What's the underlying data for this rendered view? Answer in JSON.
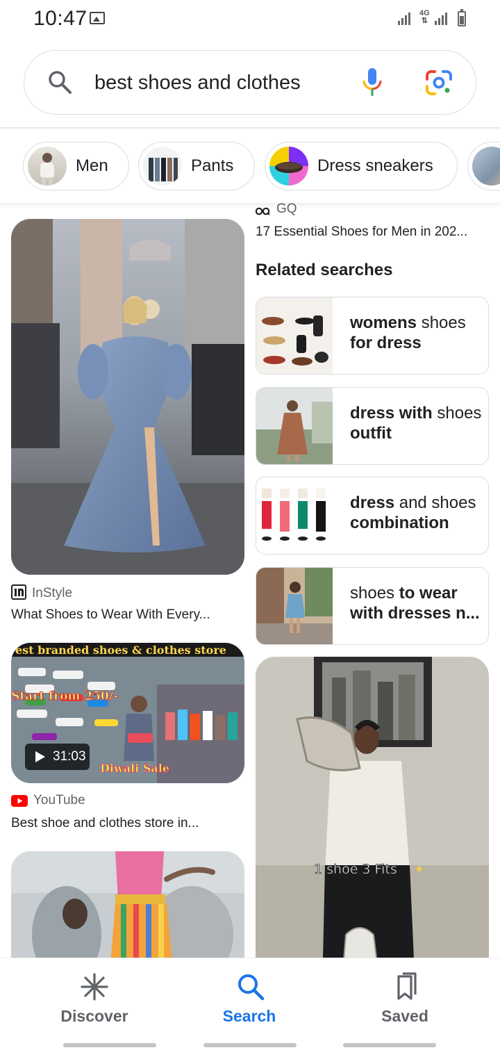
{
  "status_bar": {
    "time": "10:47",
    "network": "4G"
  },
  "search": {
    "query": "best shoes and clothes"
  },
  "chips": [
    {
      "label": "Men"
    },
    {
      "label": "Pants"
    },
    {
      "label": "Dress sneakers"
    }
  ],
  "results_left": [
    {
      "source": "InStyle",
      "title": "What Shoes to Wear With Every..."
    },
    {
      "source": "YouTube",
      "title": "Best shoe and clothes store in...",
      "duration": "31:03",
      "thumb_text": [
        "est branded shoes & clothes store",
        "Start from 250/-",
        "Diwali Sale"
      ]
    }
  ],
  "results_right_top": {
    "source": "GQ",
    "title": "17 Essential Shoes for Men in 202..."
  },
  "related": {
    "heading": "Related searches",
    "items": [
      {
        "parts": [
          {
            "t": "womens",
            "bold": true
          },
          {
            "t": " shoes ",
            "bold": false
          },
          {
            "t": "for dress",
            "bold": true
          }
        ]
      },
      {
        "parts": [
          {
            "t": "dress with",
            "bold": true
          },
          {
            "t": " shoes ",
            "bold": false
          },
          {
            "t": "outfit",
            "bold": true
          }
        ]
      },
      {
        "parts": [
          {
            "t": "dress",
            "bold": true
          },
          {
            "t": " and shoes ",
            "bold": false
          },
          {
            "t": "combination",
            "bold": true
          }
        ]
      },
      {
        "parts": [
          {
            "t": "shoes ",
            "bold": false
          },
          {
            "t": "to wear with dresses n...",
            "bold": true
          }
        ]
      }
    ]
  },
  "right_image_caption": "1 shoe 3 Fits",
  "bottom_nav": [
    {
      "label": "Discover",
      "icon": "asterisk-icon",
      "active": false
    },
    {
      "label": "Search",
      "icon": "search-icon",
      "active": true
    },
    {
      "label": "Saved",
      "icon": "bookmark-icon",
      "active": false
    }
  ],
  "colors": {
    "accent": "#1a73e8",
    "youtube_red": "#ff0000",
    "text": "#202124",
    "muted": "#5f6368"
  }
}
